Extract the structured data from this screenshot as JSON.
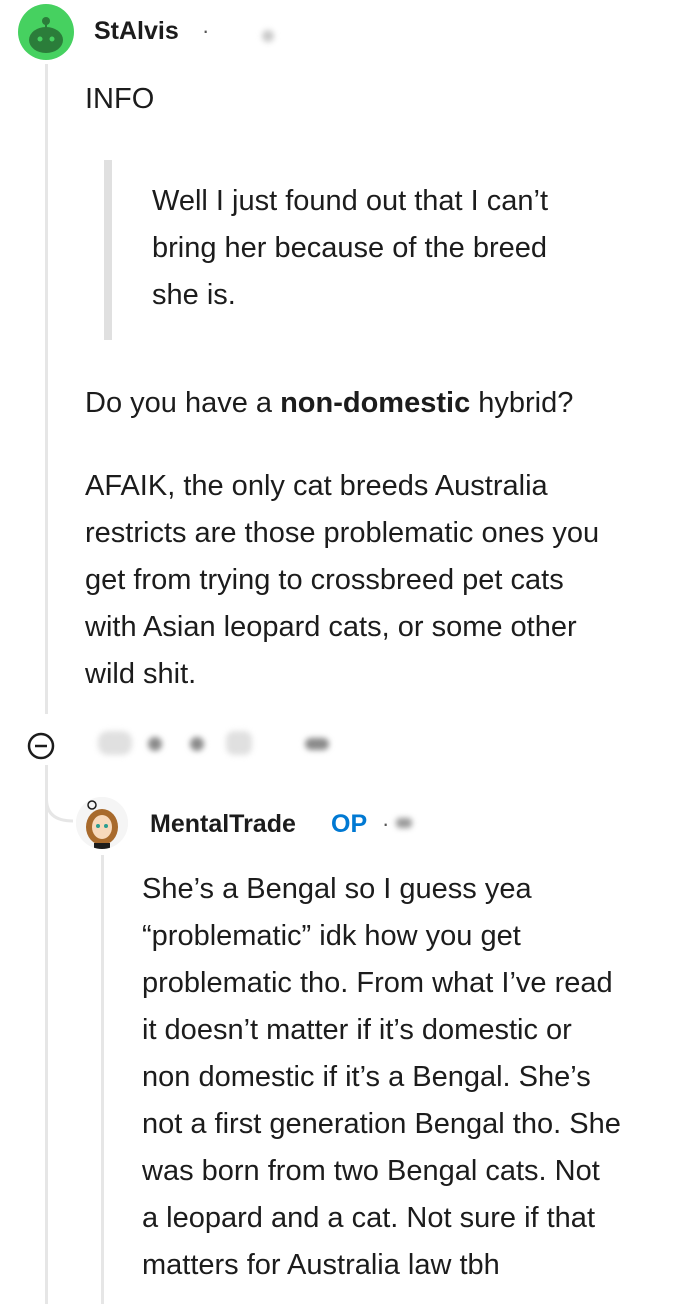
{
  "comment1": {
    "username": "StAlvis",
    "separator": "·",
    "lines": [
      "INFO"
    ],
    "quote": [
      "Well I just found out that I can’t",
      "bring her because of the breed",
      "she is."
    ],
    "question_pre": "Do you have a ",
    "question_bold": "non-domestic",
    "question_post": " hybrid?",
    "paragraph": [
      "AFAIK, the only cat breeds Australia",
      "restricts are those problematic ones you",
      "get from trying to crossbreed pet cats",
      "with Asian leopard cats, or some other",
      "wild shit."
    ]
  },
  "comment2": {
    "username": "MentalTrade",
    "badge": "OP",
    "separator": "·",
    "paragraph": [
      "She’s a Bengal so I guess yea",
      "“problematic” idk how you get",
      "problematic tho. From what I’ve read",
      "it doesn’t matter if it’s domestic or",
      "non domestic if it’s a Bengal. She’s",
      "not a first generation Bengal tho. She",
      "was born from two Bengal cats. Not",
      "a leopard and a cat. Not sure if that",
      "matters for Australia law tbh"
    ]
  },
  "icons": {
    "collapse": "minus-circle-icon",
    "avatar1": "snoo-avatar-icon",
    "avatar2": "user-avatar-icon"
  },
  "colors": {
    "op_badge": "#0079d3",
    "avatar_green": "#46d160",
    "thread_line": "#e6e6e6"
  }
}
